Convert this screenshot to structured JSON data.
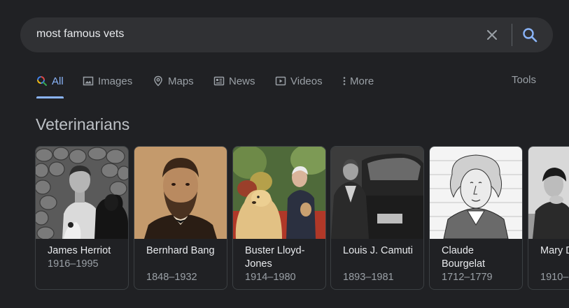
{
  "search": {
    "query": "most famous vets"
  },
  "tabs": [
    {
      "label": "All",
      "icon": "search-icon",
      "active": true
    },
    {
      "label": "Images",
      "icon": "image-icon",
      "active": false
    },
    {
      "label": "Maps",
      "icon": "map-pin-icon",
      "active": false
    },
    {
      "label": "News",
      "icon": "news-icon",
      "active": false
    },
    {
      "label": "Videos",
      "icon": "video-icon",
      "active": false
    },
    {
      "label": "More",
      "icon": "more-vert-icon",
      "active": false
    }
  ],
  "tools_label": "Tools",
  "section_title": "Veterinarians",
  "cards": [
    {
      "name": "James Herriot",
      "years": "1916–1995"
    },
    {
      "name": "Bernhard Bang",
      "years": "1848–1932"
    },
    {
      "name": "Buster Lloyd-Jones",
      "years": "1914–1980"
    },
    {
      "name": "Louis J. Camuti",
      "years": "1893–1981"
    },
    {
      "name": "Claude Bourgelat",
      "years": "1712–1779"
    },
    {
      "name": "Mary Dunlop",
      "years": "1910–"
    }
  ],
  "colors": {
    "background": "#202124",
    "searchbar": "#303134",
    "accent": "#8ab4f8",
    "muted_text": "#9aa0a6"
  }
}
